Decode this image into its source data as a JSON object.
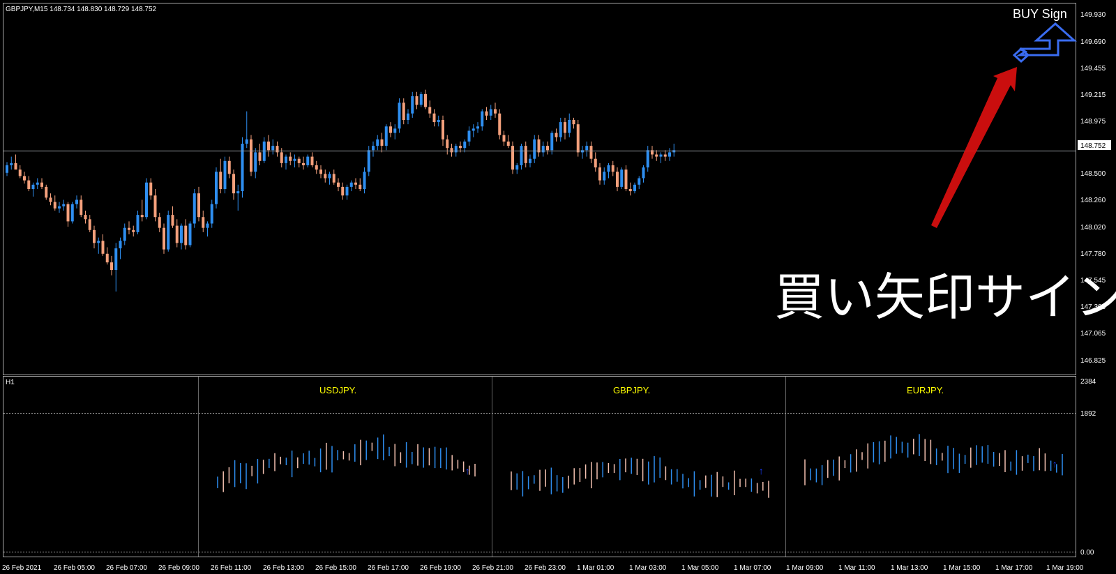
{
  "header": {
    "symbol_info": "GBPJPY,M15  148.734 148.830 148.729 148.752"
  },
  "price_axis": {
    "labels": [
      "149.930",
      "149.690",
      "149.455",
      "149.215",
      "148.975",
      "148.500",
      "148.260",
      "148.020",
      "147.780",
      "147.545",
      "147.305",
      "147.065",
      "146.825"
    ],
    "current_price": "148.752"
  },
  "annotations": {
    "buy_sign": "BUY Sign",
    "caption": "買い矢印サイン"
  },
  "sub_window": {
    "timeframe": "H1",
    "symbols": [
      "USDJPY.",
      "GBPJPY.",
      "EURJPY."
    ],
    "axis_labels": [
      "2384",
      "1892",
      "0.00"
    ]
  },
  "time_axis": {
    "labels": [
      "26 Feb 2021",
      "26 Feb 05:00",
      "26 Feb 07:00",
      "26 Feb 09:00",
      "26 Feb 11:00",
      "26 Feb 13:00",
      "26 Feb 15:00",
      "26 Feb 17:00",
      "26 Feb 19:00",
      "26 Feb 21:00",
      "26 Feb 23:00",
      "1 Mar 01:00",
      "1 Mar 03:00",
      "1 Mar 05:00",
      "1 Mar 07:00",
      "1 Mar 09:00",
      "1 Mar 11:00",
      "1 Mar 13:00",
      "1 Mar 15:00",
      "1 Mar 17:00",
      "1 Mar 19:00"
    ]
  },
  "colors": {
    "bull": "#2e8ef0",
    "bear": "#f4a07c",
    "frame": "#a8a8a8",
    "symbol_title": "#ffff00",
    "arrow_red": "#e01010",
    "buy_arrow": "#3a6cf0"
  },
  "chart_data": {
    "type": "candlestick",
    "title": "GBPJPY,M15",
    "ylim": [
      146.7,
      150.1
    ],
    "current_price": 148.752,
    "candles": [
      [
        148.55,
        148.65,
        148.52,
        148.62
      ],
      [
        148.62,
        148.7,
        148.58,
        148.64
      ],
      [
        148.64,
        148.72,
        148.6,
        148.58
      ],
      [
        148.58,
        148.62,
        148.5,
        148.52
      ],
      [
        148.52,
        148.56,
        148.45,
        148.48
      ],
      [
        148.48,
        148.52,
        148.38,
        148.4
      ],
      [
        148.4,
        148.46,
        148.33,
        148.44
      ],
      [
        148.44,
        148.5,
        148.4,
        148.46
      ],
      [
        148.46,
        148.5,
        148.4,
        148.42
      ],
      [
        148.42,
        148.44,
        148.3,
        148.32
      ],
      [
        148.32,
        148.36,
        148.25,
        148.28
      ],
      [
        148.28,
        148.34,
        148.2,
        148.22
      ],
      [
        148.22,
        148.28,
        148.18,
        148.24
      ],
      [
        148.24,
        148.3,
        148.2,
        148.26
      ],
      [
        148.26,
        148.28,
        148.05,
        148.1
      ],
      [
        148.1,
        148.28,
        148.08,
        148.26
      ],
      [
        148.26,
        148.34,
        148.22,
        148.3
      ],
      [
        148.3,
        148.34,
        148.14,
        148.16
      ],
      [
        148.16,
        148.2,
        148.08,
        148.12
      ],
      [
        148.12,
        148.16,
        148.0,
        148.02
      ],
      [
        148.02,
        148.06,
        147.85,
        147.9
      ],
      [
        147.9,
        147.95,
        147.8,
        147.92
      ],
      [
        147.92,
        147.98,
        147.78,
        147.8
      ],
      [
        147.8,
        147.86,
        147.7,
        147.72
      ],
      [
        147.72,
        147.78,
        147.6,
        147.65
      ],
      [
        147.65,
        147.9,
        147.45,
        147.85
      ],
      [
        147.85,
        147.95,
        147.75,
        147.92
      ],
      [
        147.92,
        148.08,
        147.88,
        148.04
      ],
      [
        148.04,
        148.1,
        147.98,
        148.02
      ],
      [
        148.02,
        148.06,
        147.96,
        148.0
      ],
      [
        148.0,
        148.2,
        147.98,
        148.16
      ],
      [
        148.16,
        148.3,
        148.1,
        148.14
      ],
      [
        148.14,
        148.5,
        148.12,
        148.46
      ],
      [
        148.46,
        148.5,
        148.3,
        148.34
      ],
      [
        148.34,
        148.4,
        148.1,
        148.14
      ],
      [
        148.14,
        148.18,
        148.0,
        148.04
      ],
      [
        148.04,
        148.08,
        147.8,
        147.84
      ],
      [
        147.84,
        148.2,
        147.82,
        148.16
      ],
      [
        148.16,
        148.24,
        148.04,
        148.06
      ],
      [
        148.06,
        148.12,
        147.86,
        147.9
      ],
      [
        147.9,
        148.08,
        147.84,
        148.06
      ],
      [
        148.06,
        148.12,
        147.84,
        147.88
      ],
      [
        147.88,
        148.1,
        147.86,
        148.08
      ],
      [
        148.08,
        148.4,
        148.04,
        148.36
      ],
      [
        148.36,
        148.42,
        148.1,
        148.14
      ],
      [
        148.14,
        148.2,
        148.0,
        148.04
      ],
      [
        148.04,
        148.1,
        147.96,
        148.08
      ],
      [
        148.08,
        148.3,
        148.04,
        148.26
      ],
      [
        148.26,
        148.6,
        148.22,
        148.56
      ],
      [
        148.56,
        148.68,
        148.36,
        148.4
      ],
      [
        148.4,
        148.7,
        148.36,
        148.66
      ],
      [
        148.66,
        148.7,
        148.5,
        148.54
      ],
      [
        148.54,
        148.58,
        148.3,
        148.36
      ],
      [
        148.36,
        148.44,
        148.2,
        148.38
      ],
      [
        148.38,
        148.88,
        148.32,
        148.82
      ],
      [
        148.82,
        149.12,
        148.78,
        148.86
      ],
      [
        148.86,
        148.9,
        148.52,
        148.56
      ],
      [
        148.56,
        148.78,
        148.5,
        148.74
      ],
      [
        148.74,
        148.82,
        148.62,
        148.66
      ],
      [
        148.66,
        148.88,
        148.64,
        148.84
      ],
      [
        148.84,
        148.9,
        148.7,
        148.76
      ],
      [
        148.76,
        148.86,
        148.72,
        148.8
      ],
      [
        148.8,
        148.84,
        148.7,
        148.74
      ],
      [
        148.74,
        148.78,
        148.6,
        148.64
      ],
      [
        148.64,
        148.72,
        148.58,
        148.7
      ],
      [
        148.7,
        148.74,
        148.62,
        148.66
      ],
      [
        148.66,
        148.72,
        148.6,
        148.68
      ],
      [
        148.68,
        148.7,
        148.6,
        148.64
      ],
      [
        148.64,
        148.7,
        148.58,
        148.62
      ],
      [
        148.62,
        148.72,
        148.6,
        148.7
      ],
      [
        148.7,
        148.74,
        148.6,
        148.62
      ],
      [
        148.62,
        148.66,
        148.54,
        148.58
      ],
      [
        148.58,
        148.62,
        148.5,
        148.54
      ],
      [
        148.54,
        148.58,
        148.46,
        148.5
      ],
      [
        148.5,
        148.56,
        148.44,
        148.54
      ],
      [
        148.54,
        148.58,
        148.44,
        148.46
      ],
      [
        148.46,
        148.5,
        148.38,
        148.42
      ],
      [
        148.42,
        148.46,
        148.3,
        148.34
      ],
      [
        148.34,
        148.44,
        148.3,
        148.42
      ],
      [
        148.42,
        148.48,
        148.38,
        148.46
      ],
      [
        148.46,
        148.5,
        148.4,
        148.44
      ],
      [
        148.44,
        148.5,
        148.38,
        148.4
      ],
      [
        148.4,
        148.6,
        148.36,
        148.56
      ],
      [
        148.56,
        148.8,
        148.52,
        148.76
      ],
      [
        148.76,
        148.84,
        148.7,
        148.8
      ],
      [
        148.8,
        148.9,
        148.76,
        148.86
      ],
      [
        148.86,
        148.92,
        148.74,
        148.8
      ],
      [
        148.8,
        149.0,
        148.76,
        148.98
      ],
      [
        148.98,
        149.02,
        148.88,
        148.92
      ],
      [
        148.92,
        149.0,
        148.86,
        148.96
      ],
      [
        148.96,
        149.24,
        148.92,
        149.2
      ],
      [
        149.2,
        149.24,
        149.0,
        149.04
      ],
      [
        149.04,
        149.14,
        149.0,
        149.1
      ],
      [
        149.1,
        149.3,
        149.06,
        149.26
      ],
      [
        149.26,
        149.3,
        149.14,
        149.18
      ],
      [
        149.18,
        149.3,
        149.16,
        149.28
      ],
      [
        149.28,
        149.32,
        149.14,
        149.16
      ],
      [
        149.16,
        149.22,
        149.06,
        149.1
      ],
      [
        149.1,
        149.14,
        148.98,
        149.02
      ],
      [
        149.02,
        149.08,
        148.98,
        149.04
      ],
      [
        149.04,
        149.08,
        148.8,
        148.86
      ],
      [
        148.86,
        148.9,
        148.72,
        148.78
      ],
      [
        148.78,
        148.82,
        148.7,
        148.74
      ],
      [
        148.74,
        148.82,
        148.7,
        148.8
      ],
      [
        148.8,
        148.84,
        148.74,
        148.78
      ],
      [
        148.78,
        148.86,
        148.74,
        148.84
      ],
      [
        148.84,
        148.98,
        148.8,
        148.94
      ],
      [
        148.94,
        149.0,
        148.88,
        148.96
      ],
      [
        148.96,
        149.02,
        148.92,
        148.98
      ],
      [
        148.98,
        149.14,
        148.94,
        149.12
      ],
      [
        149.12,
        149.16,
        149.04,
        149.08
      ],
      [
        149.08,
        149.18,
        149.04,
        149.14
      ],
      [
        149.14,
        149.2,
        149.06,
        149.1
      ],
      [
        149.1,
        149.14,
        148.86,
        148.9
      ],
      [
        148.9,
        148.94,
        148.8,
        148.84
      ],
      [
        148.84,
        148.9,
        148.78,
        148.8
      ],
      [
        148.8,
        148.84,
        148.54,
        148.58
      ],
      [
        148.58,
        148.64,
        148.54,
        148.62
      ],
      [
        148.62,
        148.82,
        148.58,
        148.8
      ],
      [
        148.8,
        148.84,
        148.6,
        148.64
      ],
      [
        148.64,
        148.72,
        148.6,
        148.68
      ],
      [
        148.68,
        148.9,
        148.64,
        148.86
      ],
      [
        148.86,
        148.9,
        148.7,
        148.74
      ],
      [
        148.74,
        148.84,
        148.7,
        148.8
      ],
      [
        148.8,
        148.84,
        148.72,
        148.76
      ],
      [
        148.76,
        148.94,
        148.72,
        148.92
      ],
      [
        148.92,
        148.96,
        148.84,
        148.88
      ],
      [
        148.88,
        149.06,
        148.84,
        149.02
      ],
      [
        149.02,
        149.06,
        148.86,
        148.92
      ],
      [
        148.92,
        149.1,
        148.88,
        149.04
      ],
      [
        149.04,
        149.06,
        148.96,
        149.0
      ],
      [
        149.0,
        149.04,
        148.7,
        148.74
      ],
      [
        148.74,
        148.8,
        148.68,
        148.76
      ],
      [
        148.76,
        148.84,
        148.7,
        148.8
      ],
      [
        148.8,
        148.84,
        148.64,
        148.68
      ],
      [
        148.68,
        148.74,
        148.56,
        148.6
      ],
      [
        148.6,
        148.64,
        148.44,
        148.48
      ],
      [
        148.48,
        148.6,
        148.44,
        148.56
      ],
      [
        148.56,
        148.64,
        148.5,
        148.62
      ],
      [
        148.62,
        148.66,
        148.52,
        148.56
      ],
      [
        148.56,
        148.6,
        148.38,
        148.42
      ],
      [
        148.42,
        148.6,
        148.4,
        148.58
      ],
      [
        148.58,
        148.62,
        148.38,
        148.4
      ],
      [
        148.4,
        148.46,
        148.34,
        148.38
      ],
      [
        148.38,
        148.46,
        148.36,
        148.44
      ],
      [
        148.44,
        148.52,
        148.4,
        148.5
      ],
      [
        148.5,
        148.62,
        148.46,
        148.6
      ],
      [
        148.6,
        148.8,
        148.56,
        148.76
      ],
      [
        148.76,
        148.8,
        148.68,
        148.72
      ],
      [
        148.72,
        148.76,
        148.66,
        148.7
      ],
      [
        148.7,
        148.74,
        148.64,
        148.72
      ],
      [
        148.72,
        148.76,
        148.66,
        148.7
      ],
      [
        148.7,
        148.78,
        148.66,
        148.74
      ],
      [
        148.74,
        148.82,
        148.7,
        148.76
      ]
    ]
  }
}
